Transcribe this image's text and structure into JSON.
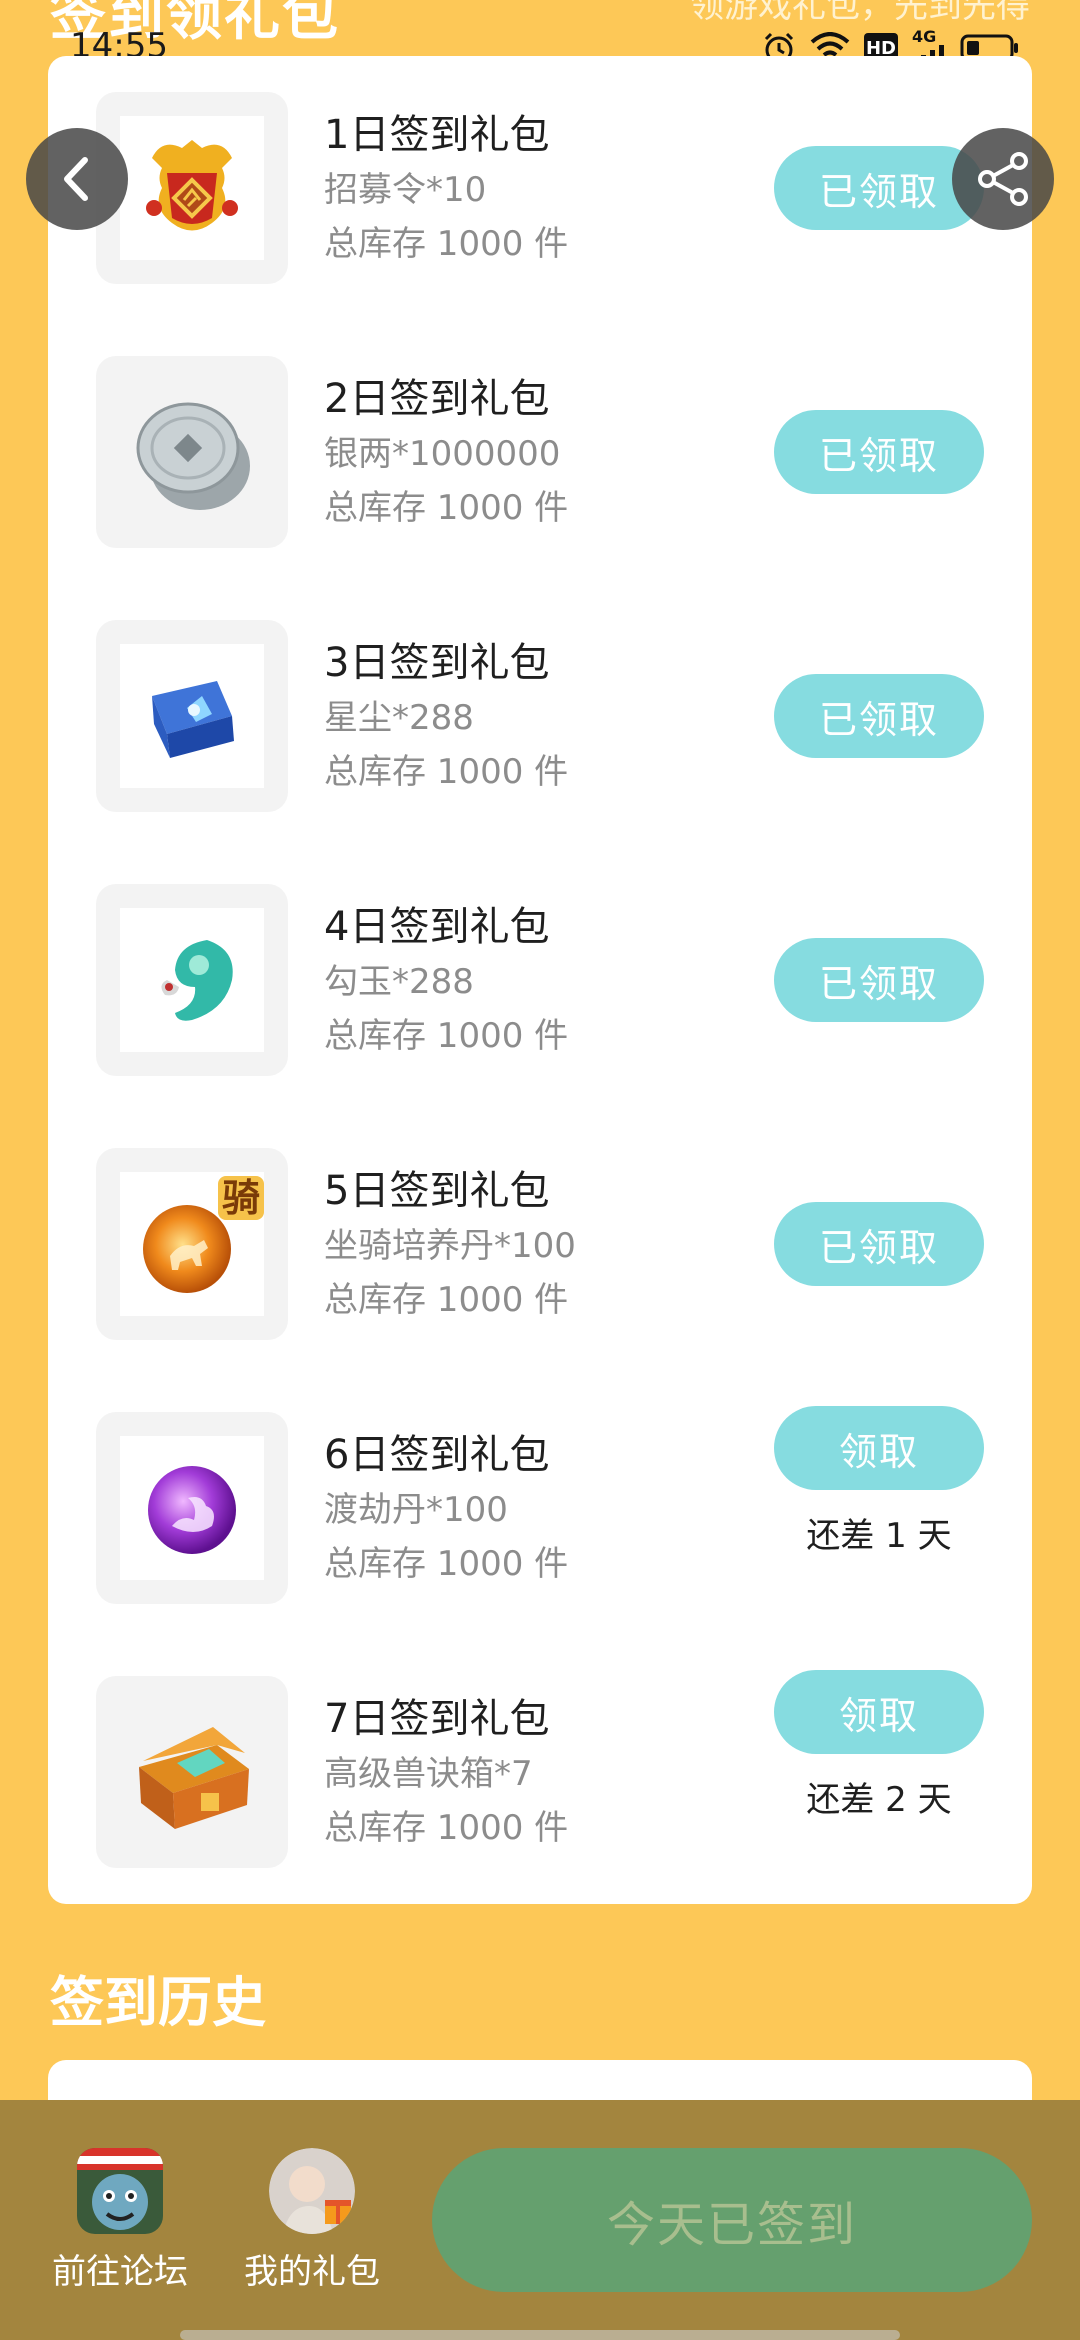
{
  "header": {
    "title_partial": "签到领礼包",
    "note_partial": "领游戏礼包，先到先得"
  },
  "status_bar": {
    "time": "14:55",
    "hd": "HD",
    "network": "4G"
  },
  "gifts": [
    {
      "title": "1日签到礼包",
      "item": "招募令*10",
      "stock": "总库存 1000 件",
      "button": "已领取",
      "state": "claimed",
      "icon": "recruit-token-icon"
    },
    {
      "title": "2日签到礼包",
      "item": "银两*1000000",
      "stock": "总库存 1000 件",
      "button": "已领取",
      "state": "claimed",
      "icon": "silver-coins-icon"
    },
    {
      "title": "3日签到礼包",
      "item": "星尘*288",
      "stock": "总库存 1000 件",
      "button": "已领取",
      "state": "claimed",
      "icon": "stardust-chest-icon"
    },
    {
      "title": "4日签到礼包",
      "item": "勾玉*288",
      "stock": "总库存 1000 件",
      "button": "已领取",
      "state": "claimed",
      "icon": "magatama-icon"
    },
    {
      "title": "5日签到礼包",
      "item": "坐骑培养丹*100",
      "stock": "总库存 1000 件",
      "button": "已领取",
      "state": "claimed",
      "icon": "mount-pill-icon",
      "badge": "骑"
    },
    {
      "title": "6日签到礼包",
      "item": "渡劫丹*100",
      "stock": "总库存 1000 件",
      "button": "领取",
      "state": "pending",
      "remain": "还差 1 天",
      "icon": "tribulation-pill-icon"
    },
    {
      "title": "7日签到礼包",
      "item": "高级兽诀箱*7",
      "stock": "总库存 1000 件",
      "button": "领取",
      "state": "pending",
      "remain": "还差 2 天",
      "icon": "beast-chest-icon"
    }
  ],
  "history": {
    "title": "签到历史"
  },
  "bottom_bar": {
    "forum_label": "前往论坛",
    "mygift_label": "我的礼包",
    "checkin_label": "今天已签到"
  },
  "colors": {
    "background": "#FDC857",
    "button": "#86DCE0",
    "bottom_bar": "#A3853E",
    "checkin_button": "#65A06E"
  }
}
